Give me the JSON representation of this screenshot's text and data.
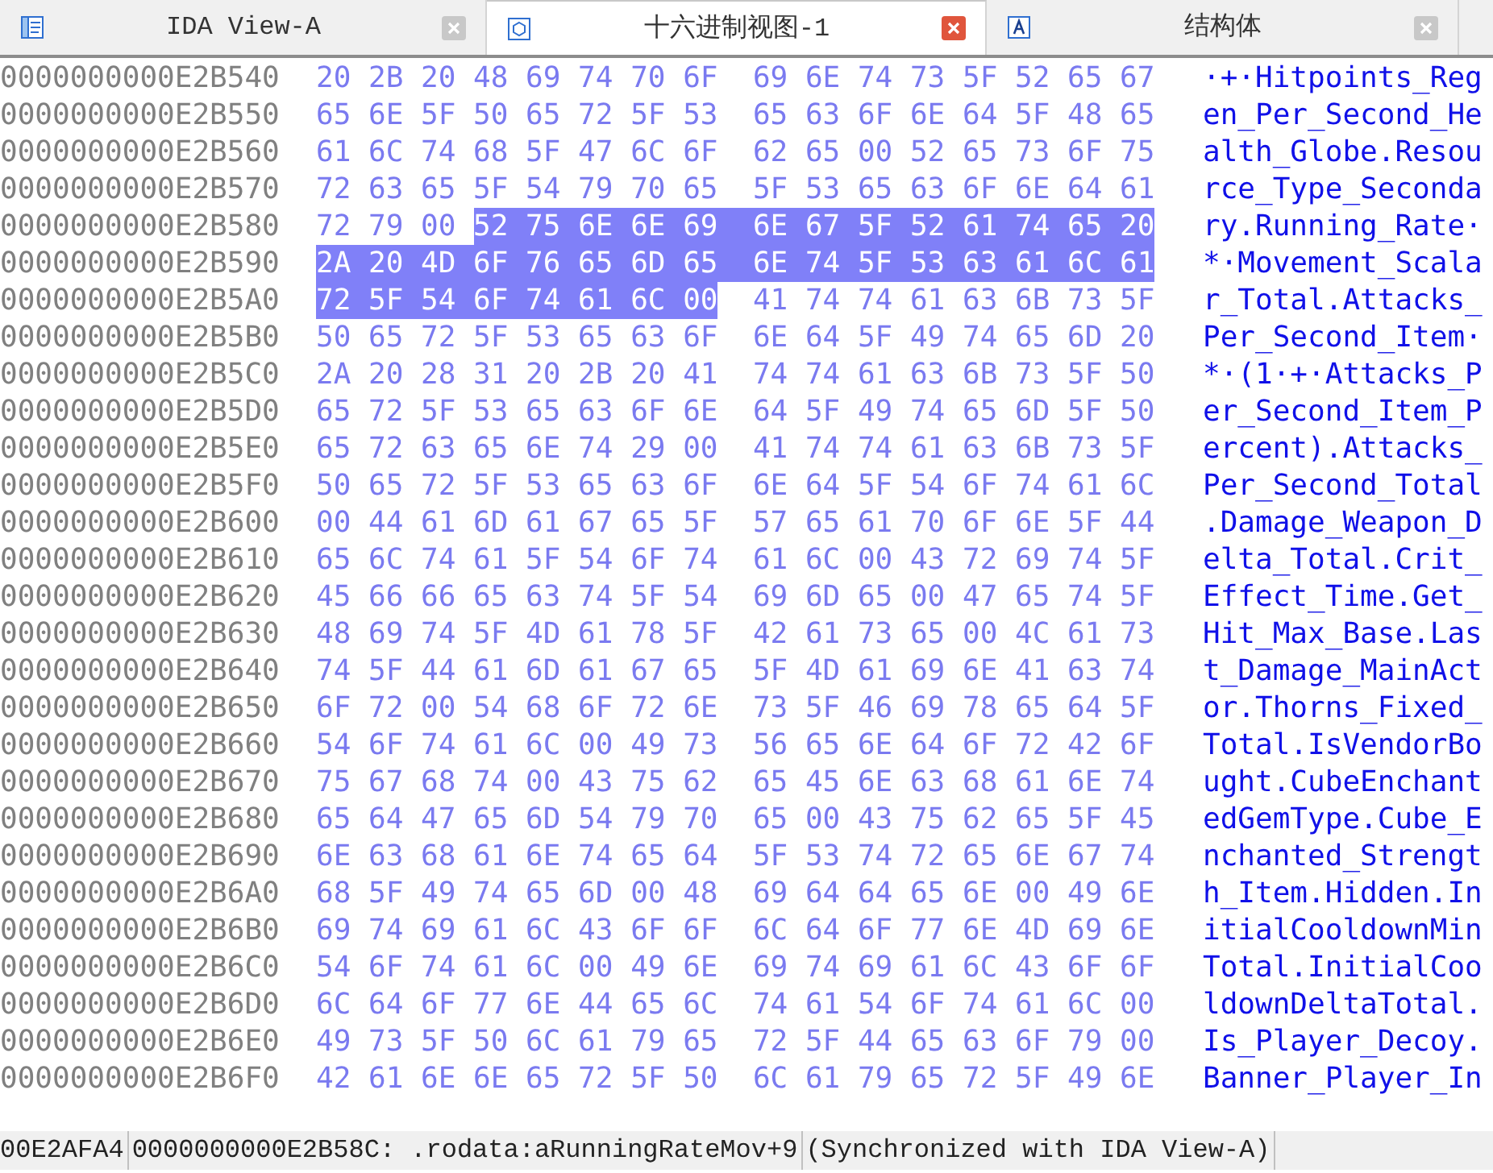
{
  "tabs": [
    {
      "kind": "disasm",
      "label": "IDA View-A",
      "selected": false
    },
    {
      "kind": "hex",
      "label": "十六进制视图-1",
      "selected": true
    },
    {
      "kind": "struct",
      "label": "结构体",
      "selected": false
    }
  ],
  "rows": [
    {
      "address": "0000000000E2B540",
      "groups": [
        [
          {
            "bytes": "20 2B 20 48 69 74 70 6F",
            "selected": false
          }
        ],
        [
          {
            "bytes": "69 6E 74 73 5F 52 65 67",
            "selected": false
          }
        ]
      ],
      "ascii": "·+·Hitpoints_Reg"
    },
    {
      "address": "0000000000E2B550",
      "groups": [
        [
          {
            "bytes": "65 6E 5F 50 65 72 5F 53",
            "selected": false
          }
        ],
        [
          {
            "bytes": "65 63 6F 6E 64 5F 48 65",
            "selected": false
          }
        ]
      ],
      "ascii": "en_Per_Second_He"
    },
    {
      "address": "0000000000E2B560",
      "groups": [
        [
          {
            "bytes": "61 6C 74 68 5F 47 6C 6F",
            "selected": false
          }
        ],
        [
          {
            "bytes": "62 65 00 52 65 73 6F 75",
            "selected": false
          }
        ]
      ],
      "ascii": "alth_Globe.Resou"
    },
    {
      "address": "0000000000E2B570",
      "groups": [
        [
          {
            "bytes": "72 63 65 5F 54 79 70 65",
            "selected": false
          }
        ],
        [
          {
            "bytes": "5F 53 65 63 6F 6E 64 61",
            "selected": false
          }
        ]
      ],
      "ascii": "rce_Type_Seconda"
    },
    {
      "address": "0000000000E2B580",
      "groups": [
        [
          {
            "bytes": "72 79 00",
            "selected": false
          },
          {
            "bytes": "52 75 6E 6E 69",
            "selected": true
          }
        ],
        [
          {
            "bytes": "6E 67 5F 52 61 74 65 20",
            "selected": true
          }
        ]
      ],
      "ascii": "ry.Running_Rate·"
    },
    {
      "address": "0000000000E2B590",
      "groups": [
        [
          {
            "bytes": "2A 20 4D 6F 76 65 6D 65",
            "selected": true
          }
        ],
        [
          {
            "bytes": "6E 74 5F 53 63 61 6C 61",
            "selected": true
          }
        ]
      ],
      "ascii": "*·Movement_Scala"
    },
    {
      "address": "0000000000E2B5A0",
      "groups": [
        [
          {
            "bytes": "72 5F 54 6F 74 61 6C 00",
            "selected": true
          }
        ],
        [
          {
            "bytes": "41 74 74 61 63 6B 73 5F",
            "selected": false
          }
        ]
      ],
      "ascii": "r_Total.Attacks_"
    },
    {
      "address": "0000000000E2B5B0",
      "groups": [
        [
          {
            "bytes": "50 65 72 5F 53 65 63 6F",
            "selected": false
          }
        ],
        [
          {
            "bytes": "6E 64 5F 49 74 65 6D 20",
            "selected": false
          }
        ]
      ],
      "ascii": "Per_Second_Item·"
    },
    {
      "address": "0000000000E2B5C0",
      "groups": [
        [
          {
            "bytes": "2A 20 28 31 20 2B 20 41",
            "selected": false
          }
        ],
        [
          {
            "bytes": "74 74 61 63 6B 73 5F 50",
            "selected": false
          }
        ]
      ],
      "ascii": "*·(1·+·Attacks_P"
    },
    {
      "address": "0000000000E2B5D0",
      "groups": [
        [
          {
            "bytes": "65 72 5F 53 65 63 6F 6E",
            "selected": false
          }
        ],
        [
          {
            "bytes": "64 5F 49 74 65 6D 5F 50",
            "selected": false
          }
        ]
      ],
      "ascii": "er_Second_Item_P"
    },
    {
      "address": "0000000000E2B5E0",
      "groups": [
        [
          {
            "bytes": "65 72 63 65 6E 74 29 00",
            "selected": false
          }
        ],
        [
          {
            "bytes": "41 74 74 61 63 6B 73 5F",
            "selected": false
          }
        ]
      ],
      "ascii": "ercent).Attacks_"
    },
    {
      "address": "0000000000E2B5F0",
      "groups": [
        [
          {
            "bytes": "50 65 72 5F 53 65 63 6F",
            "selected": false
          }
        ],
        [
          {
            "bytes": "6E 64 5F 54 6F 74 61 6C",
            "selected": false
          }
        ]
      ],
      "ascii": "Per_Second_Total"
    },
    {
      "address": "0000000000E2B600",
      "groups": [
        [
          {
            "bytes": "00 44 61 6D 61 67 65 5F",
            "selected": false
          }
        ],
        [
          {
            "bytes": "57 65 61 70 6F 6E 5F 44",
            "selected": false
          }
        ]
      ],
      "ascii": ".Damage_Weapon_D"
    },
    {
      "address": "0000000000E2B610",
      "groups": [
        [
          {
            "bytes": "65 6C 74 61 5F 54 6F 74",
            "selected": false
          }
        ],
        [
          {
            "bytes": "61 6C 00 43 72 69 74 5F",
            "selected": false
          }
        ]
      ],
      "ascii": "elta_Total.Crit_"
    },
    {
      "address": "0000000000E2B620",
      "groups": [
        [
          {
            "bytes": "45 66 66 65 63 74 5F 54",
            "selected": false
          }
        ],
        [
          {
            "bytes": "69 6D 65 00 47 65 74 5F",
            "selected": false
          }
        ]
      ],
      "ascii": "Effect_Time.Get_"
    },
    {
      "address": "0000000000E2B630",
      "groups": [
        [
          {
            "bytes": "48 69 74 5F 4D 61 78 5F",
            "selected": false
          }
        ],
        [
          {
            "bytes": "42 61 73 65 00 4C 61 73",
            "selected": false
          }
        ]
      ],
      "ascii": "Hit_Max_Base.Las"
    },
    {
      "address": "0000000000E2B640",
      "groups": [
        [
          {
            "bytes": "74 5F 44 61 6D 61 67 65",
            "selected": false
          }
        ],
        [
          {
            "bytes": "5F 4D 61 69 6E 41 63 74",
            "selected": false
          }
        ]
      ],
      "ascii": "t_Damage_MainAct"
    },
    {
      "address": "0000000000E2B650",
      "groups": [
        [
          {
            "bytes": "6F 72 00 54 68 6F 72 6E",
            "selected": false
          }
        ],
        [
          {
            "bytes": "73 5F 46 69 78 65 64 5F",
            "selected": false
          }
        ]
      ],
      "ascii": "or.Thorns_Fixed_"
    },
    {
      "address": "0000000000E2B660",
      "groups": [
        [
          {
            "bytes": "54 6F 74 61 6C 00 49 73",
            "selected": false
          }
        ],
        [
          {
            "bytes": "56 65 6E 64 6F 72 42 6F",
            "selected": false
          }
        ]
      ],
      "ascii": "Total.IsVendorBo"
    },
    {
      "address": "0000000000E2B670",
      "groups": [
        [
          {
            "bytes": "75 67 68 74 00 43 75 62",
            "selected": false
          }
        ],
        [
          {
            "bytes": "65 45 6E 63 68 61 6E 74",
            "selected": false
          }
        ]
      ],
      "ascii": "ught.CubeEnchant"
    },
    {
      "address": "0000000000E2B680",
      "groups": [
        [
          {
            "bytes": "65 64 47 65 6D 54 79 70",
            "selected": false
          }
        ],
        [
          {
            "bytes": "65 00 43 75 62 65 5F 45",
            "selected": false
          }
        ]
      ],
      "ascii": "edGemType.Cube_E"
    },
    {
      "address": "0000000000E2B690",
      "groups": [
        [
          {
            "bytes": "6E 63 68 61 6E 74 65 64",
            "selected": false
          }
        ],
        [
          {
            "bytes": "5F 53 74 72 65 6E 67 74",
            "selected": false
          }
        ]
      ],
      "ascii": "nchanted_Strengt"
    },
    {
      "address": "0000000000E2B6A0",
      "groups": [
        [
          {
            "bytes": "68 5F 49 74 65 6D 00 48",
            "selected": false
          }
        ],
        [
          {
            "bytes": "69 64 64 65 6E 00 49 6E",
            "selected": false
          }
        ]
      ],
      "ascii": "h_Item.Hidden.In"
    },
    {
      "address": "0000000000E2B6B0",
      "groups": [
        [
          {
            "bytes": "69 74 69 61 6C 43 6F 6F",
            "selected": false
          }
        ],
        [
          {
            "bytes": "6C 64 6F 77 6E 4D 69 6E",
            "selected": false
          }
        ]
      ],
      "ascii": "itialCooldownMin"
    },
    {
      "address": "0000000000E2B6C0",
      "groups": [
        [
          {
            "bytes": "54 6F 74 61 6C 00 49 6E",
            "selected": false
          }
        ],
        [
          {
            "bytes": "69 74 69 61 6C 43 6F 6F",
            "selected": false
          }
        ]
      ],
      "ascii": "Total.InitialCoo"
    },
    {
      "address": "0000000000E2B6D0",
      "groups": [
        [
          {
            "bytes": "6C 64 6F 77 6E 44 65 6C",
            "selected": false
          }
        ],
        [
          {
            "bytes": "74 61 54 6F 74 61 6C 00",
            "selected": false
          }
        ]
      ],
      "ascii": "ldownDeltaTotal."
    },
    {
      "address": "0000000000E2B6E0",
      "groups": [
        [
          {
            "bytes": "49 73 5F 50 6C 61 79 65",
            "selected": false
          }
        ],
        [
          {
            "bytes": "72 5F 44 65 63 6F 79 00",
            "selected": false
          }
        ]
      ],
      "ascii": "Is_Player_Decoy."
    },
    {
      "address": "0000000000E2B6F0",
      "groups": [
        [
          {
            "bytes": "42 61 6E 6E 65 72 5F 50",
            "selected": false
          }
        ],
        [
          {
            "bytes": "6C 61 79 65 72 5F 49 6E",
            "selected": false
          }
        ]
      ],
      "ascii": "Banner_Player_In"
    }
  ],
  "status_bar": [
    "00E2AFA4",
    "0000000000E2B58C: .rodata:aRunningRateMov+9",
    "(Synchronized with IDA View-A)"
  ]
}
